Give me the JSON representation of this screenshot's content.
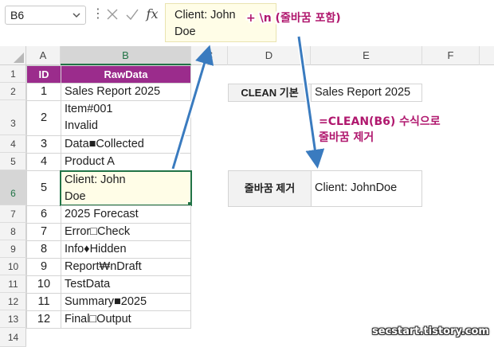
{
  "formula_bar": {
    "name_box": "B6",
    "formula_lines": [
      "Client: John",
      "Doe"
    ],
    "fx_label": "fx"
  },
  "columns": [
    "A",
    "B",
    "C",
    "D",
    "E",
    "F"
  ],
  "table": {
    "headers": [
      "ID",
      "RawData"
    ],
    "rows": [
      {
        "row": "2",
        "id": "1",
        "text": [
          "Sales Report 2025"
        ]
      },
      {
        "row": "3",
        "id": "2",
        "text": [
          "Item#001",
          "Invalid"
        ]
      },
      {
        "row": "4",
        "id": "3",
        "text": [
          "Data■Collected"
        ]
      },
      {
        "row": "5",
        "id": "4",
        "text": [
          "Product A"
        ]
      },
      {
        "row": "6",
        "id": "5",
        "text": [
          "Client: John",
          "Doe"
        ]
      },
      {
        "row": "7",
        "id": "6",
        "text": [
          "2025 Forecast"
        ]
      },
      {
        "row": "8",
        "id": "7",
        "text": [
          "Error□Check"
        ]
      },
      {
        "row": "9",
        "id": "8",
        "text": [
          "Info♦Hidden"
        ]
      },
      {
        "row": "10",
        "id": "9",
        "text": [
          "Report₩nDraft"
        ]
      },
      {
        "row": "11",
        "id": "10",
        "text": [
          "TestData"
        ]
      },
      {
        "row": "12",
        "id": "11",
        "text": [
          "Summary■2025"
        ]
      },
      {
        "row": "13",
        "id": "12",
        "text": [
          "Final□Output"
        ]
      }
    ],
    "header_row": "1",
    "last_row": "14"
  },
  "clean_basic": {
    "label": "CLEAN 기본",
    "value": "Sales Report 2025"
  },
  "line_removed": {
    "label": "줄바꿈 제거",
    "value": "Client: JohnDoe"
  },
  "annotations": {
    "newline_note": "+ \\n (줄바꿈 포함)",
    "formula_note_1": "=CLEAN(B6) 수식으로",
    "formula_note_2": "줄바꿈 제거"
  },
  "watermark": "secstart.tistory.com",
  "colors": {
    "header_purple": "#9b2c8c",
    "selected_fill": "#fffde7",
    "selected_border": "#217346",
    "label_fill": "#f2f2f2",
    "arrow_blue": "#3a7bbf",
    "annotation": "#b0186e"
  }
}
